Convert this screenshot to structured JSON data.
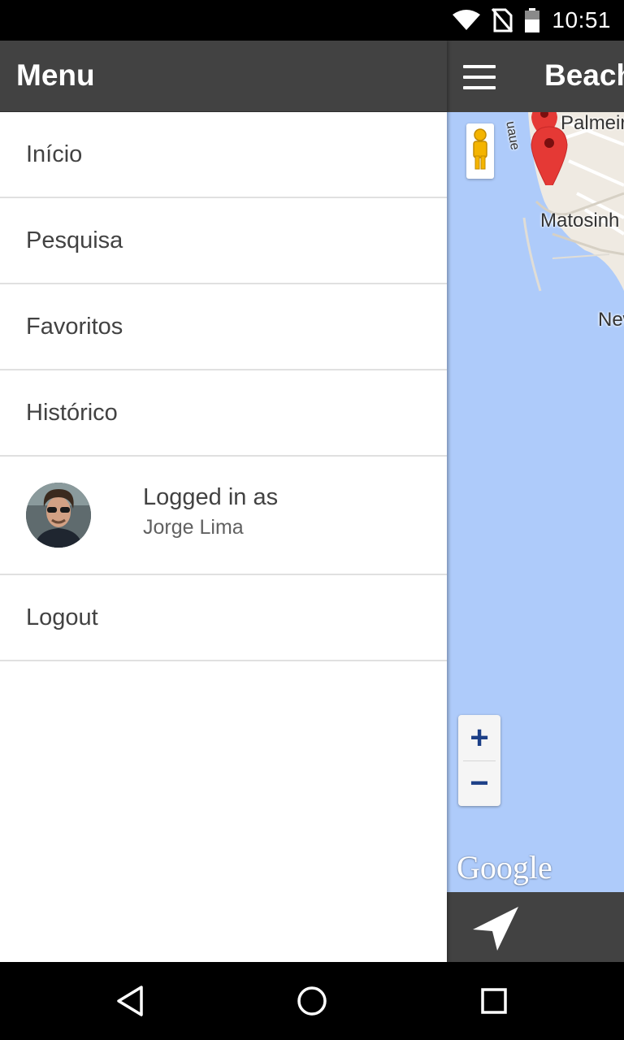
{
  "status": {
    "time": "10:51"
  },
  "drawer": {
    "title": "Menu",
    "items": [
      {
        "label": "Início"
      },
      {
        "label": "Pesquisa"
      },
      {
        "label": "Favoritos"
      },
      {
        "label": "Histórico"
      }
    ],
    "user": {
      "caption": "Logged in as",
      "name": "Jorge Lima"
    },
    "logout_label": "Logout"
  },
  "app": {
    "title": "Beach",
    "map": {
      "labels": [
        "Palmeir",
        "Matosinh",
        "New",
        "uaue"
      ],
      "zoom_in": "+",
      "zoom_out": "−",
      "attribution": "Google"
    }
  },
  "icons": {
    "wifi": "wifi-icon",
    "no_sim": "no-sim-icon",
    "battery": "battery-icon",
    "menu": "hamburger-menu-icon",
    "pegman": "street-view-pegman-icon",
    "map_pin": "map-pin-icon",
    "navigation": "navigation-arrow-icon",
    "back": "back-icon",
    "home": "home-icon",
    "recents": "recents-icon"
  },
  "colors": {
    "toolbar": "#424242",
    "map_water": "#aecbfa",
    "pin": "#e53935"
  }
}
